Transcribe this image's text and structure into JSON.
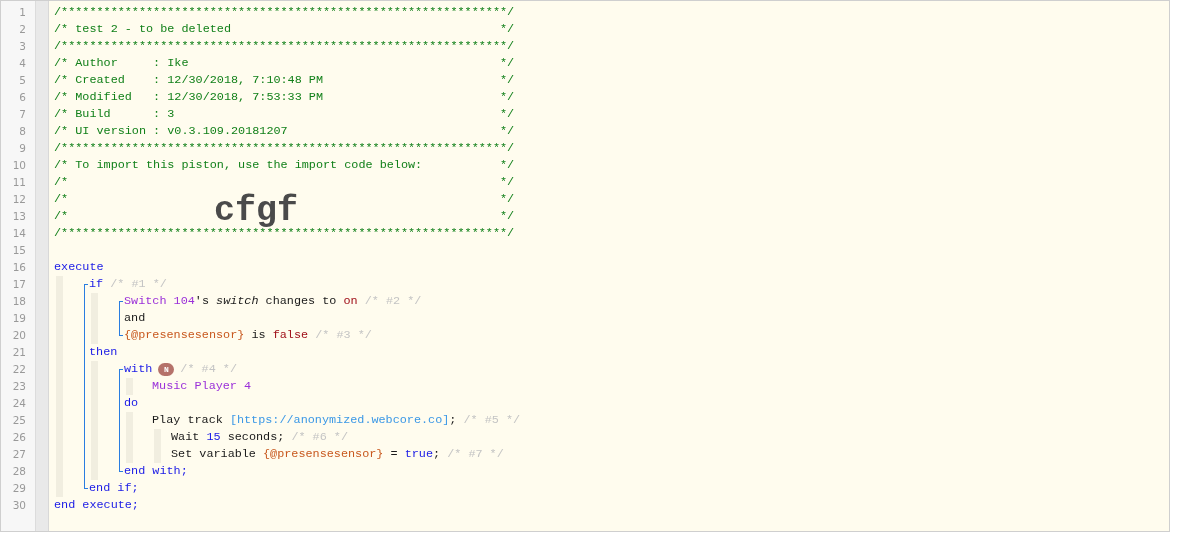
{
  "editor": {
    "overlay_text": "cfgf",
    "lines": [
      {
        "kind": "line",
        "number": "1",
        "tokens": [
          {
            "kind": "comment",
            "text": "/***************************************************************/"
          }
        ]
      },
      {
        "kind": "line",
        "number": "2",
        "tokens": [
          {
            "kind": "comment",
            "text": "/* test 2 - to be deleted                                      */"
          }
        ]
      },
      {
        "kind": "line",
        "number": "3",
        "tokens": [
          {
            "kind": "comment",
            "text": "/***************************************************************/"
          }
        ]
      },
      {
        "kind": "line",
        "number": "4",
        "tokens": [
          {
            "kind": "comment",
            "text": "/* Author     : Ike                                            */"
          }
        ]
      },
      {
        "kind": "line",
        "number": "5",
        "tokens": [
          {
            "kind": "comment",
            "text": "/* Created    : 12/30/2018, 7:10:48 PM                         */"
          }
        ]
      },
      {
        "kind": "line",
        "number": "6",
        "tokens": [
          {
            "kind": "comment",
            "text": "/* Modified   : 12/30/2018, 7:53:33 PM                         */"
          }
        ]
      },
      {
        "kind": "line",
        "number": "7",
        "tokens": [
          {
            "kind": "comment",
            "text": "/* Build      : 3                                              */"
          }
        ]
      },
      {
        "kind": "line",
        "number": "8",
        "tokens": [
          {
            "kind": "comment",
            "text": "/* UI version : v0.3.109.20181207                              */"
          }
        ]
      },
      {
        "kind": "line",
        "number": "9",
        "tokens": [
          {
            "kind": "comment",
            "text": "/***************************************************************/"
          }
        ]
      },
      {
        "kind": "line",
        "number": "10",
        "tokens": [
          {
            "kind": "comment",
            "text": "/* To import this piston, use the import code below:           */"
          }
        ]
      },
      {
        "kind": "line",
        "number": "11",
        "tokens": [
          {
            "kind": "comment",
            "text": "/*                                                             */"
          }
        ]
      },
      {
        "kind": "line",
        "number": "12",
        "tokens": [
          {
            "kind": "comment",
            "text": "/*                                                             */"
          }
        ]
      },
      {
        "kind": "line",
        "number": "13",
        "tokens": [
          {
            "kind": "comment",
            "text": "/*                                                             */"
          }
        ]
      },
      {
        "kind": "line",
        "number": "14",
        "tokens": [
          {
            "kind": "comment",
            "text": "/***************************************************************/"
          }
        ]
      },
      {
        "kind": "line",
        "number": "15"
      },
      {
        "kind": "line",
        "number": "16",
        "tokens": [
          {
            "kind": "keyword",
            "text": "execute"
          }
        ],
        "children": [
          {
            "kind": "block",
            "items": [
              {
                "kind": "line",
                "number": "17",
                "tokens": [
                  {
                    "kind": "keyword",
                    "text": "if"
                  },
                  {
                    "kind": "note",
                    "text": "/* #1 */"
                  }
                ],
                "children": [
                  {
                    "kind": "block",
                    "items": [
                      {
                        "kind": "line",
                        "number": "18",
                        "tokens": [
                          {
                            "kind": "device",
                            "text": "Switch 104"
                          },
                          {
                            "kind": "plain",
                            "text": "'s "
                          },
                          {
                            "kind": "italic",
                            "text": "switch"
                          },
                          {
                            "kind": "plain",
                            "text": " changes to "
                          },
                          {
                            "kind": "value",
                            "text": "on"
                          },
                          {
                            "kind": "note",
                            "text": "/* #2 */"
                          }
                        ]
                      },
                      {
                        "kind": "line",
                        "number": "19",
                        "tokens": [
                          {
                            "kind": "plain",
                            "text": "and"
                          }
                        ]
                      },
                      {
                        "kind": "line",
                        "number": "20",
                        "tokens": [
                          {
                            "kind": "variable",
                            "text": "{@presensesensor}"
                          },
                          {
                            "kind": "plain",
                            "text": " is "
                          },
                          {
                            "kind": "value",
                            "text": "false"
                          },
                          {
                            "kind": "note",
                            "text": "/* #3 */"
                          }
                        ]
                      }
                    ]
                  }
                ]
              },
              {
                "kind": "line",
                "number": "21",
                "tokens": [
                  {
                    "kind": "keyword",
                    "text": "then"
                  }
                ],
                "children": [
                  {
                    "kind": "block",
                    "items": [
                      {
                        "kind": "line",
                        "number": "22",
                        "tokens": [
                          {
                            "kind": "keyword",
                            "text": "with"
                          },
                          {
                            "kind": "badge",
                            "text": "N"
                          },
                          {
                            "kind": "note",
                            "text": "/* #4 */"
                          }
                        ],
                        "children": [
                          {
                            "kind": "line",
                            "number": "23",
                            "tokens": [
                              {
                                "kind": "device",
                                "text": "Music Player 4"
                              }
                            ]
                          }
                        ]
                      },
                      {
                        "kind": "line",
                        "number": "24",
                        "tokens": [
                          {
                            "kind": "keyword",
                            "text": "do"
                          }
                        ],
                        "children": [
                          {
                            "kind": "line",
                            "number": "25",
                            "tokens": [
                              {
                                "kind": "plain",
                                "text": "Play track "
                              },
                              {
                                "kind": "url",
                                "text": "[https://anonymized.webcore.co]"
                              },
                              {
                                "kind": "plain",
                                "text": ";"
                              },
                              {
                                "kind": "note",
                                "text": "/* #5 */"
                              }
                            ],
                            "children": [
                              {
                                "kind": "line",
                                "number": "26",
                                "tokens": [
                                  {
                                    "kind": "plain",
                                    "text": "Wait "
                                  },
                                  {
                                    "kind": "number",
                                    "text": "15"
                                  },
                                  {
                                    "kind": "plain",
                                    "text": " seconds;"
                                  },
                                  {
                                    "kind": "note",
                                    "text": "/* #6 */"
                                  }
                                ]
                              },
                              {
                                "kind": "line",
                                "number": "27",
                                "tokens": [
                                  {
                                    "kind": "plain",
                                    "text": "Set variable "
                                  },
                                  {
                                    "kind": "variable",
                                    "text": "{@presensesensor}"
                                  },
                                  {
                                    "kind": "plain",
                                    "text": " = "
                                  },
                                  {
                                    "kind": "keyword",
                                    "text": "true"
                                  },
                                  {
                                    "kind": "plain",
                                    "text": ";"
                                  },
                                  {
                                    "kind": "note",
                                    "text": "/* #7 */"
                                  }
                                ]
                              }
                            ]
                          }
                        ]
                      },
                      {
                        "kind": "line",
                        "number": "28",
                        "tokens": [
                          {
                            "kind": "keyword",
                            "text": "end with;"
                          }
                        ]
                      }
                    ]
                  }
                ]
              },
              {
                "kind": "line",
                "number": "29",
                "tokens": [
                  {
                    "kind": "keyword",
                    "text": "end if;"
                  }
                ]
              }
            ]
          }
        ]
      },
      {
        "kind": "line",
        "number": "30",
        "tokens": [
          {
            "kind": "keyword",
            "text": "end execute;"
          }
        ]
      }
    ]
  }
}
